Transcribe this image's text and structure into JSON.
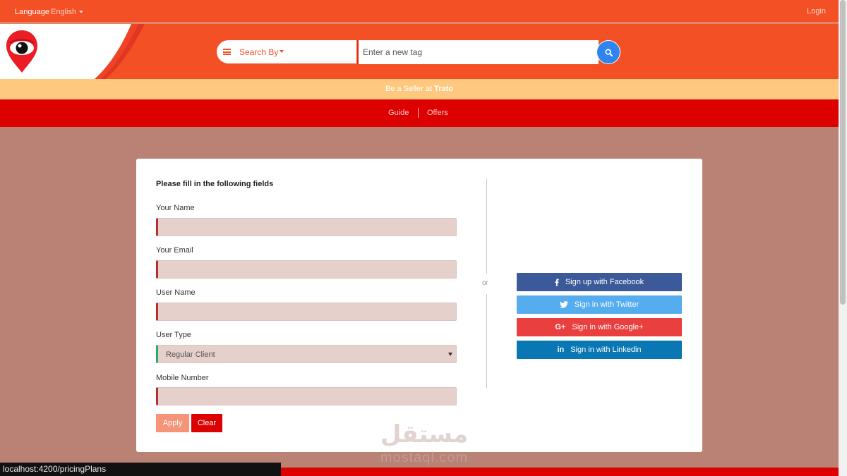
{
  "topbar": {
    "language_label": "Language",
    "language_value": "English",
    "login_label": "Login"
  },
  "header": {
    "search_by_label": "Search By",
    "tag_placeholder": "Enter a new tag"
  },
  "seller_bar": {
    "prefix": "Be a Seller at ",
    "brand": "Trato"
  },
  "nav": {
    "guide": "Guide",
    "offers": "Offers"
  },
  "form": {
    "title": "Please fill in the following fields",
    "fields": [
      {
        "label": "Your Name",
        "value": ""
      },
      {
        "label": "Your Email",
        "value": ""
      },
      {
        "label": "User Name",
        "value": ""
      },
      {
        "label": "User Type",
        "value": "Regular Client"
      },
      {
        "label": "Mobile Number",
        "value": ""
      }
    ],
    "apply_label": "Apply",
    "clear_label": "Clear"
  },
  "divider": {
    "or_label": "or"
  },
  "social": {
    "facebook": "Sign up with Facebook",
    "twitter": "Sign in with Twitter",
    "google": "Sign in with Google+",
    "linkedin": "Sign in with Linkedin"
  },
  "status_bar": {
    "url": "localhost:4200/pricingPlans"
  },
  "watermark": {
    "arabic": "مستقل",
    "latin": "mostaql.com"
  },
  "colors": {
    "primary_orange": "#f45025",
    "nav_red": "#dc0000",
    "seller_yellow": "#fec97f",
    "page_background": "#b98274",
    "facebook": "#3c5a99",
    "twitter": "#55acee",
    "google": "#e93f3f",
    "linkedin": "#0a77b5",
    "search_button": "#2f84ee"
  },
  "icons": {
    "menu": "hamburger-icon",
    "search": "search-icon",
    "facebook": "facebook-icon",
    "twitter": "twitter-icon",
    "google": "google-plus-icon",
    "linkedin": "linkedin-icon",
    "logo": "eye-pin-logo"
  }
}
